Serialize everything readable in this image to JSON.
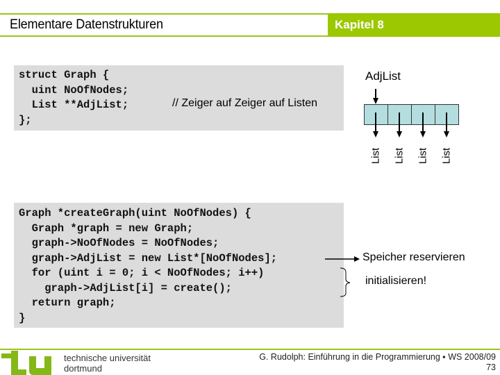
{
  "header": {
    "title": "Elementare Datenstrukturen",
    "chapter": "Kapitel 8",
    "accent_color": "#9bc800"
  },
  "struct_code": {
    "lines": [
      "struct Graph {",
      "  uint NoOfNodes;",
      "  List **AdjList;",
      "};"
    ],
    "comment": "// Zeiger auf Zeiger auf Listen"
  },
  "diagram": {
    "array_label": "AdjList",
    "cell_color": "#b4dde0",
    "cells": [
      {
        "target": "List"
      },
      {
        "target": "List"
      },
      {
        "target": "List"
      },
      {
        "target": "List"
      }
    ]
  },
  "function_code": {
    "lines": [
      "Graph *createGraph(uint NoOfNodes) {",
      "  Graph *graph = new Graph;",
      "  graph->NoOfNodes = NoOfNodes;",
      "  graph->AdjList = new List*[NoOfNodes];",
      "  for (uint i = 0; i < NoOfNodes; i++)",
      "    graph->AdjList[i] = create();",
      "  return graph;",
      "}"
    ]
  },
  "notes": {
    "allocate": "Speicher reservieren",
    "initialize": "initialisieren!"
  },
  "footer": {
    "university_line1": "technische universität",
    "university_line2": "dortmund",
    "credit": "G. Rudolph: Einführung in die Programmierung ▪ WS 2008/09",
    "page_number": "73"
  }
}
